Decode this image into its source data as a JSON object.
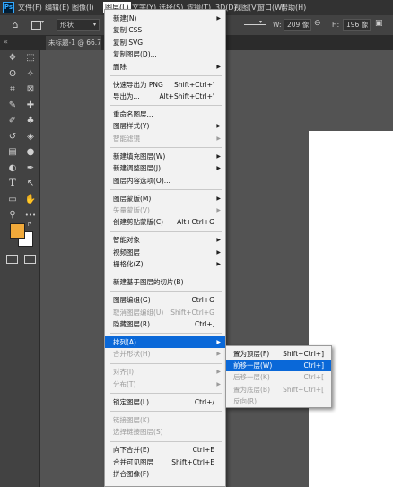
{
  "app": {
    "logo": "Ps"
  },
  "menubar": [
    {
      "key": "file",
      "label": "文件(F)"
    },
    {
      "key": "edit",
      "label": "编辑(E)"
    },
    {
      "key": "image",
      "label": "图像(I)"
    },
    {
      "key": "layer",
      "label": "图层(L)"
    },
    {
      "key": "type",
      "label": "文字(Y)"
    },
    {
      "key": "select",
      "label": "选择(S)"
    },
    {
      "key": "filter",
      "label": "滤镜(T)"
    },
    {
      "key": "3d",
      "label": "3D(D)"
    },
    {
      "key": "view",
      "label": "视图(V)"
    },
    {
      "key": "window",
      "label": "窗口(W)"
    },
    {
      "key": "help",
      "label": "帮助(H)"
    }
  ],
  "options": {
    "mode": "形状",
    "w_label": "W:",
    "w_value": "209 像",
    "h_label": "H:",
    "h_value": "196 像"
  },
  "doc_tab": "未标题-1 @ 66.7",
  "layer_menu": [
    {
      "label": "新建(N)",
      "shortcut": "",
      "submenu": true,
      "disabled": false
    },
    {
      "label": "复制 CSS",
      "shortcut": "",
      "submenu": false,
      "disabled": false
    },
    {
      "label": "复制 SVG",
      "shortcut": "",
      "submenu": false,
      "disabled": false
    },
    {
      "label": "复制图层(D)...",
      "shortcut": "",
      "submenu": false,
      "disabled": false
    },
    {
      "label": "删除",
      "shortcut": "",
      "submenu": true,
      "disabled": false
    },
    {
      "sep": true
    },
    {
      "label": "快速导出为 PNG",
      "shortcut": "Shift+Ctrl+'",
      "submenu": false,
      "disabled": false
    },
    {
      "label": "导出为...",
      "shortcut": "Alt+Shift+Ctrl+'",
      "submenu": false,
      "disabled": false
    },
    {
      "sep": true
    },
    {
      "label": "重命名图层...",
      "shortcut": "",
      "submenu": false,
      "disabled": false
    },
    {
      "label": "图层样式(Y)",
      "shortcut": "",
      "submenu": true,
      "disabled": false
    },
    {
      "label": "智能滤镜",
      "shortcut": "",
      "submenu": true,
      "disabled": true
    },
    {
      "sep": true
    },
    {
      "label": "新建填充图层(W)",
      "shortcut": "",
      "submenu": true,
      "disabled": false
    },
    {
      "label": "新建调整图层(J)",
      "shortcut": "",
      "submenu": true,
      "disabled": false
    },
    {
      "label": "图层内容选项(O)...",
      "shortcut": "",
      "submenu": false,
      "disabled": false
    },
    {
      "sep": true
    },
    {
      "label": "图层蒙版(M)",
      "shortcut": "",
      "submenu": true,
      "disabled": false
    },
    {
      "label": "矢量蒙版(V)",
      "shortcut": "",
      "submenu": true,
      "disabled": true
    },
    {
      "label": "创建剪贴蒙版(C)",
      "shortcut": "Alt+Ctrl+G",
      "submenu": false,
      "disabled": false
    },
    {
      "sep": true
    },
    {
      "label": "智能对象",
      "shortcut": "",
      "submenu": true,
      "disabled": false
    },
    {
      "label": "视频图层",
      "shortcut": "",
      "submenu": true,
      "disabled": false
    },
    {
      "label": "栅格化(Z)",
      "shortcut": "",
      "submenu": true,
      "disabled": false
    },
    {
      "sep": true
    },
    {
      "label": "新建基于图层的切片(B)",
      "shortcut": "",
      "submenu": false,
      "disabled": false
    },
    {
      "sep": true
    },
    {
      "label": "图层编组(G)",
      "shortcut": "Ctrl+G",
      "submenu": false,
      "disabled": false
    },
    {
      "label": "取消图层编组(U)",
      "shortcut": "Shift+Ctrl+G",
      "submenu": false,
      "disabled": true
    },
    {
      "label": "隐藏图层(R)",
      "shortcut": "Ctrl+,",
      "submenu": false,
      "disabled": false
    },
    {
      "sep": true
    },
    {
      "label": "排列(A)",
      "shortcut": "",
      "submenu": true,
      "disabled": false,
      "highlight": true
    },
    {
      "label": "合并形状(H)",
      "shortcut": "",
      "submenu": true,
      "disabled": true
    },
    {
      "sep": true
    },
    {
      "label": "对齐(I)",
      "shortcut": "",
      "submenu": true,
      "disabled": true
    },
    {
      "label": "分布(T)",
      "shortcut": "",
      "submenu": true,
      "disabled": true
    },
    {
      "sep": true
    },
    {
      "label": "锁定图层(L)...",
      "shortcut": "Ctrl+/",
      "submenu": false,
      "disabled": false
    },
    {
      "sep": true
    },
    {
      "label": "链接图层(K)",
      "shortcut": "",
      "submenu": false,
      "disabled": true
    },
    {
      "label": "选择链接图层(S)",
      "shortcut": "",
      "submenu": false,
      "disabled": true
    },
    {
      "sep": true
    },
    {
      "label": "向下合并(E)",
      "shortcut": "Ctrl+E",
      "submenu": false,
      "disabled": false
    },
    {
      "label": "合并可见图层",
      "shortcut": "Shift+Ctrl+E",
      "submenu": false,
      "disabled": false
    },
    {
      "label": "拼合图像(F)",
      "shortcut": "",
      "submenu": false,
      "disabled": false
    }
  ],
  "arrange_submenu": [
    {
      "label": "置为顶层(F)",
      "shortcut": "Shift+Ctrl+]",
      "disabled": false
    },
    {
      "label": "前移一层(W)",
      "shortcut": "Ctrl+]",
      "disabled": false,
      "highlight": true
    },
    {
      "label": "后移一层(K)",
      "shortcut": "Ctrl+[",
      "disabled": true
    },
    {
      "label": "置为底层(B)",
      "shortcut": "Shift+Ctrl+[",
      "disabled": true
    },
    {
      "label": "反向(R)",
      "shortcut": "",
      "disabled": true
    }
  ],
  "colors": {
    "foreground": "#f0a93a",
    "background": "#ffffff",
    "highlight": "#0a68d8"
  },
  "tool_icons": [
    "move-icon",
    "marquee-icon",
    "lasso-icon",
    "magic-wand-icon",
    "crop-icon",
    "frame-icon",
    "eyedropper-icon",
    "healing-icon",
    "brush-icon",
    "stamp-icon",
    "history-brush-icon",
    "eraser-icon",
    "gradient-icon",
    "blur-icon",
    "dodge-icon",
    "pen-icon",
    "type-icon",
    "path-select-icon",
    "rectangle-icon",
    "hand-icon",
    "zoom-icon",
    "more-icon"
  ]
}
